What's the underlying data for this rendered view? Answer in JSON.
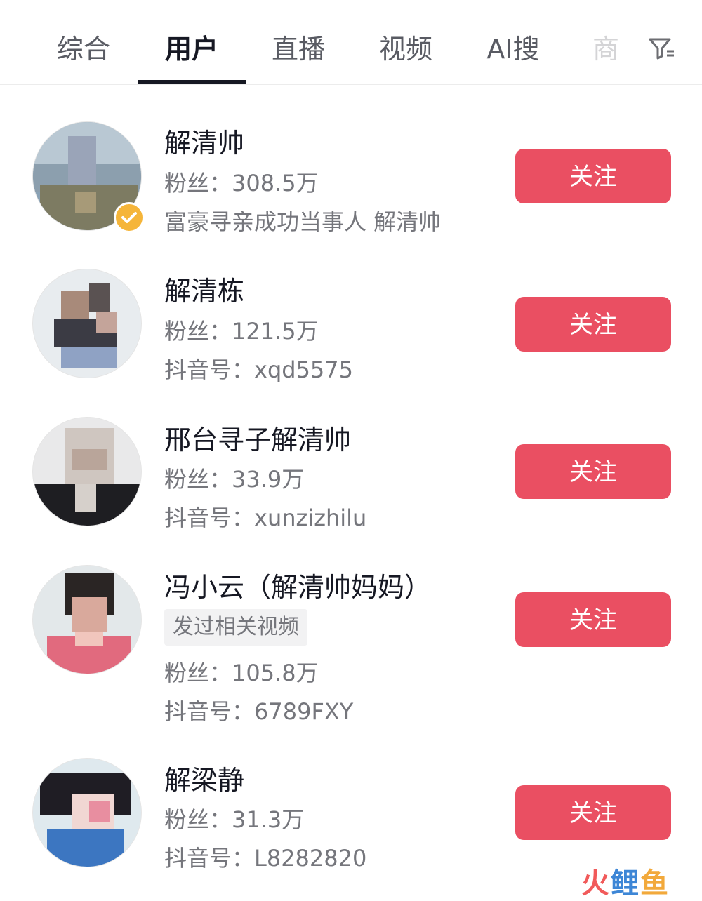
{
  "tabs": [
    {
      "label": "综合",
      "active": false
    },
    {
      "label": "用户",
      "active": true
    },
    {
      "label": "直播",
      "active": false
    },
    {
      "label": "视频",
      "active": false
    },
    {
      "label": "AI搜",
      "active": false
    },
    {
      "label": "商",
      "active": false
    }
  ],
  "filter_icon": "filter-icon",
  "users": [
    {
      "name": "解清帅",
      "fans": "粉丝：308.5万",
      "detail": "富豪寻亲成功当事人 解清帅",
      "verified": true,
      "follow_label": "关注"
    },
    {
      "name": "解清栋",
      "fans": "粉丝：121.5万",
      "detail": "抖音号：xqd5575",
      "verified": false,
      "follow_label": "关注"
    },
    {
      "name": "邢台寻子解清帅",
      "fans": "粉丝：33.9万",
      "detail": "抖音号：xunzizhilu",
      "verified": false,
      "follow_label": "关注"
    },
    {
      "name": "冯小云（解清帅妈妈）",
      "tag": "发过相关视频",
      "fans": "粉丝：105.8万",
      "detail": "抖音号：6789FXY",
      "verified": false,
      "follow_label": "关注"
    },
    {
      "name": "解梁静",
      "fans": "粉丝：31.3万",
      "detail": "抖音号：L8282820",
      "verified": false,
      "follow_label": "关注"
    }
  ],
  "watermark": {
    "part1": "火",
    "part2": "鲤",
    "part3": "鱼"
  },
  "colors": {
    "follow_button": "#ea4f62",
    "verified_badge": "#f5b53a",
    "active_tab_underline": "#161823"
  }
}
